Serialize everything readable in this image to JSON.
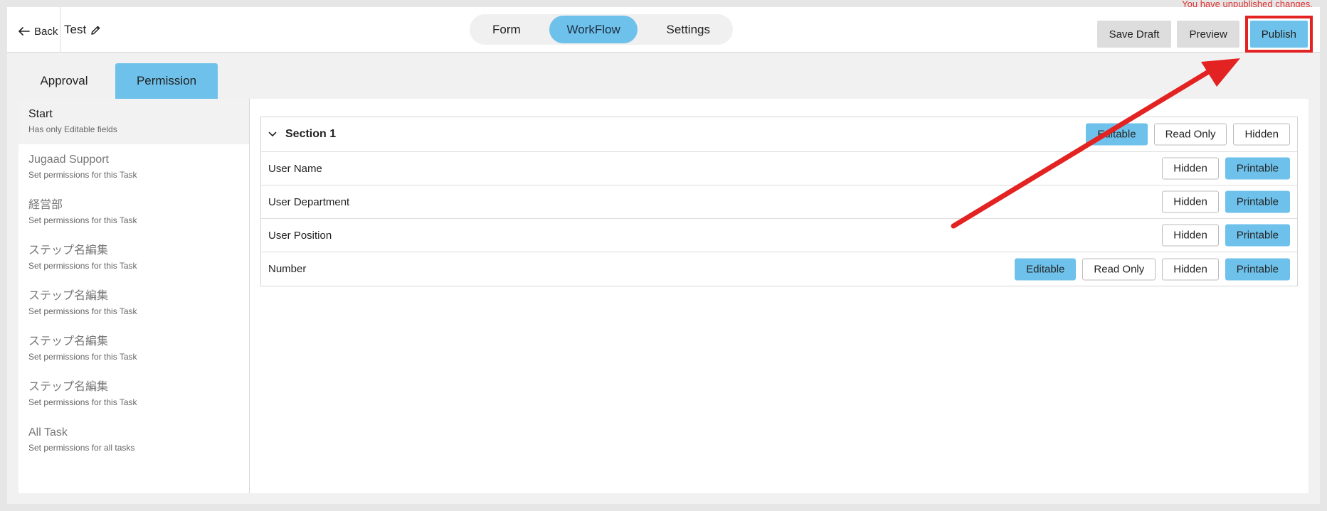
{
  "notice": "You have unpublished changes.",
  "header": {
    "back_label": "Back",
    "title": "Test",
    "tabs": [
      "Form",
      "WorkFlow",
      "Settings"
    ],
    "active_tab": "WorkFlow",
    "save_draft_label": "Save Draft",
    "preview_label": "Preview",
    "publish_label": "Publish"
  },
  "subtabs": {
    "approval_label": "Approval",
    "permission_label": "Permission",
    "active": "Permission"
  },
  "tasks": [
    {
      "title": "Start",
      "subtitle": "Has only Editable fields"
    },
    {
      "title": "Jugaad Support",
      "subtitle": "Set permissions for this Task"
    },
    {
      "title": "経営部",
      "subtitle": "Set permissions for this Task"
    },
    {
      "title": "ステップ名編集",
      "subtitle": "Set permissions for this Task"
    },
    {
      "title": "ステップ名編集",
      "subtitle": "Set permissions for this Task"
    },
    {
      "title": "ステップ名編集",
      "subtitle": "Set permissions for this Task"
    },
    {
      "title": "ステップ名編集",
      "subtitle": "Set permissions for this Task"
    },
    {
      "title": "All Task",
      "subtitle": "Set permissions for all tasks"
    }
  ],
  "section": {
    "title": "Section 1",
    "buttons": [
      {
        "label": "Editable",
        "active": true
      },
      {
        "label": "Read Only",
        "active": false
      },
      {
        "label": "Hidden",
        "active": false
      }
    ]
  },
  "fields": [
    {
      "label": "User Name",
      "buttons": [
        {
          "label": "Hidden",
          "active": false
        },
        {
          "label": "Printable",
          "active": true
        }
      ]
    },
    {
      "label": "User Department",
      "buttons": [
        {
          "label": "Hidden",
          "active": false
        },
        {
          "label": "Printable",
          "active": true
        }
      ]
    },
    {
      "label": "User Position",
      "buttons": [
        {
          "label": "Hidden",
          "active": false
        },
        {
          "label": "Printable",
          "active": true
        }
      ]
    },
    {
      "label": "Number",
      "buttons": [
        {
          "label": "Editable",
          "active": true
        },
        {
          "label": "Read Only",
          "active": false
        },
        {
          "label": "Hidden",
          "active": false
        },
        {
          "label": "Printable",
          "active": true
        }
      ]
    }
  ],
  "colors": {
    "accent": "#6ec1ea",
    "highlight": "#e32222"
  },
  "icons": {
    "back": "arrow-left-icon",
    "edit": "pencil-icon",
    "collapse": "chevron-down-icon"
  }
}
